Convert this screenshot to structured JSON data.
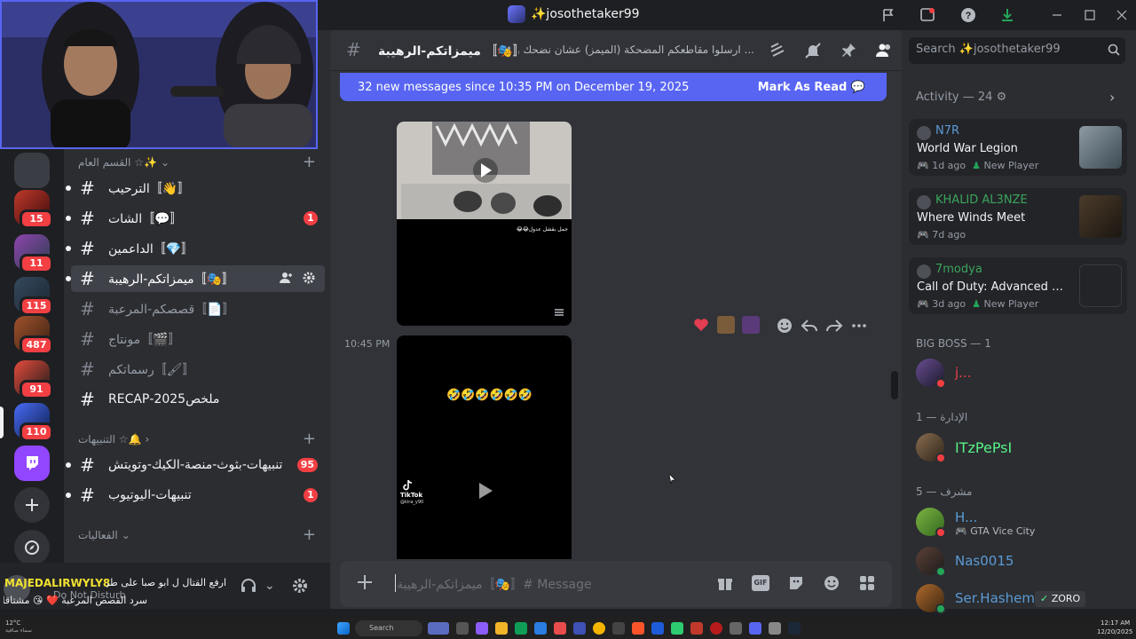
{
  "window": {
    "title": "✨josothetaker99"
  },
  "rail": {
    "badges": [
      "15",
      "11",
      "115",
      "487",
      "91",
      "110"
    ]
  },
  "channels": {
    "categories": [
      {
        "label": "القسم العام ☆✨"
      },
      {
        "label": "التنبيهات ☆🔔"
      },
      {
        "label": "الفعاليات"
      }
    ],
    "items": [
      {
        "name": "الترحيب",
        "emoji": "👋",
        "badge": ""
      },
      {
        "name": "الشات",
        "emoji": "💬",
        "badge": "1"
      },
      {
        "name": "الداعمين",
        "emoji": "💎",
        "badge": ""
      },
      {
        "name": "ميمزاتكم-الرهيبة",
        "emoji": "🎭",
        "badge": ""
      },
      {
        "name": "قصصكم-المرعبة",
        "emoji": "📄",
        "badge": ""
      },
      {
        "name": "مونتاج",
        "emoji": "🎬",
        "badge": ""
      },
      {
        "name": "رسماتكم",
        "emoji": "🖌",
        "badge": ""
      },
      {
        "name": "ملخص2025-RECAP",
        "emoji": "",
        "badge": ""
      },
      {
        "name": "تنبيهات-بثوث-منصة-الكيك-وتويتش",
        "emoji": "",
        "badge": "95"
      },
      {
        "name": "تنبيهات-اليوتيوب",
        "emoji": "",
        "badge": "1"
      }
    ]
  },
  "userpanel": {
    "name": "MAJEDALIRWYLY8",
    "status": "Do Not Disturb",
    "ticker1": "ارفع القتال ل ابو صبا على طريقه :",
    "ticker2": "سرد القصص المرعبة ❤️ 😘 مشتاقلك"
  },
  "chat": {
    "channel_name": "ميمزاتكم-الرهيبة",
    "channel_bracket": "〚🎭〛",
    "topic": "... ارسلوا مقاطعكم المضحكة (الميمز) عشان نضحك وننبسط",
    "new_messages": "32 new messages since 10:35 PM on December 19, 2025",
    "mark_as_read": "Mark As Read",
    "timestamp": "10:45 PM",
    "video_caption_1": "جمل بقشل عدول😂😂",
    "video_caption_2": "🤣🤣🤣🤣🤣🤣",
    "tiktok_label": "TikTok",
    "tiktok_user": "@kira_y90",
    "composer_placeholder": "Message #〚🎭〛ميمزاتكم-الرهيبة",
    "gif_label": "GIF"
  },
  "search": {
    "placeholder": "Search ✨josothetaker99"
  },
  "members": {
    "activity_header": "Activity — 24",
    "activity": [
      {
        "user": "N7R",
        "game": "World War Legion",
        "time": "1d ago",
        "tag": "New Player",
        "color": "#5b9bd5"
      },
      {
        "user": "KHALID AL3NZE",
        "game": "Where Winds Meet",
        "time": "7d ago",
        "tag": "",
        "color": "#3ba55c"
      },
      {
        "user": "7modya",
        "game": "Call of Duty: Advanced Wa...",
        "time": "3d ago",
        "tag": "New Player",
        "color": "#3ba55c"
      }
    ],
    "groups": [
      {
        "header": "BIG BOSS — 1",
        "members": [
          {
            "name": "j...",
            "sub": "",
            "color": "#f23f43",
            "status": "#f23f43"
          }
        ]
      },
      {
        "header": "الإدارة — 1",
        "members": [
          {
            "name": "ITzPePsI",
            "sub": "",
            "color": "#57f287",
            "status": "#f23f43"
          }
        ]
      },
      {
        "header": "مشرف — 5",
        "members": [
          {
            "name": "H...",
            "sub": "GTA Vice City",
            "color": "#5b9bd5",
            "status": "#f23f43"
          },
          {
            "name": "Nas0015",
            "sub": "",
            "color": "#5b9bd5",
            "status": "#23a55a"
          },
          {
            "name": "Ser.Hashem",
            "sub": "",
            "color": "#5b9bd5",
            "status": "#23a55a",
            "tag": "ZORO"
          }
        ]
      }
    ]
  },
  "taskbar": {
    "search": "Search",
    "temp": "12°C",
    "weather": "سماء صافية",
    "time": "12:17 AM",
    "date": "12/20/2025"
  }
}
